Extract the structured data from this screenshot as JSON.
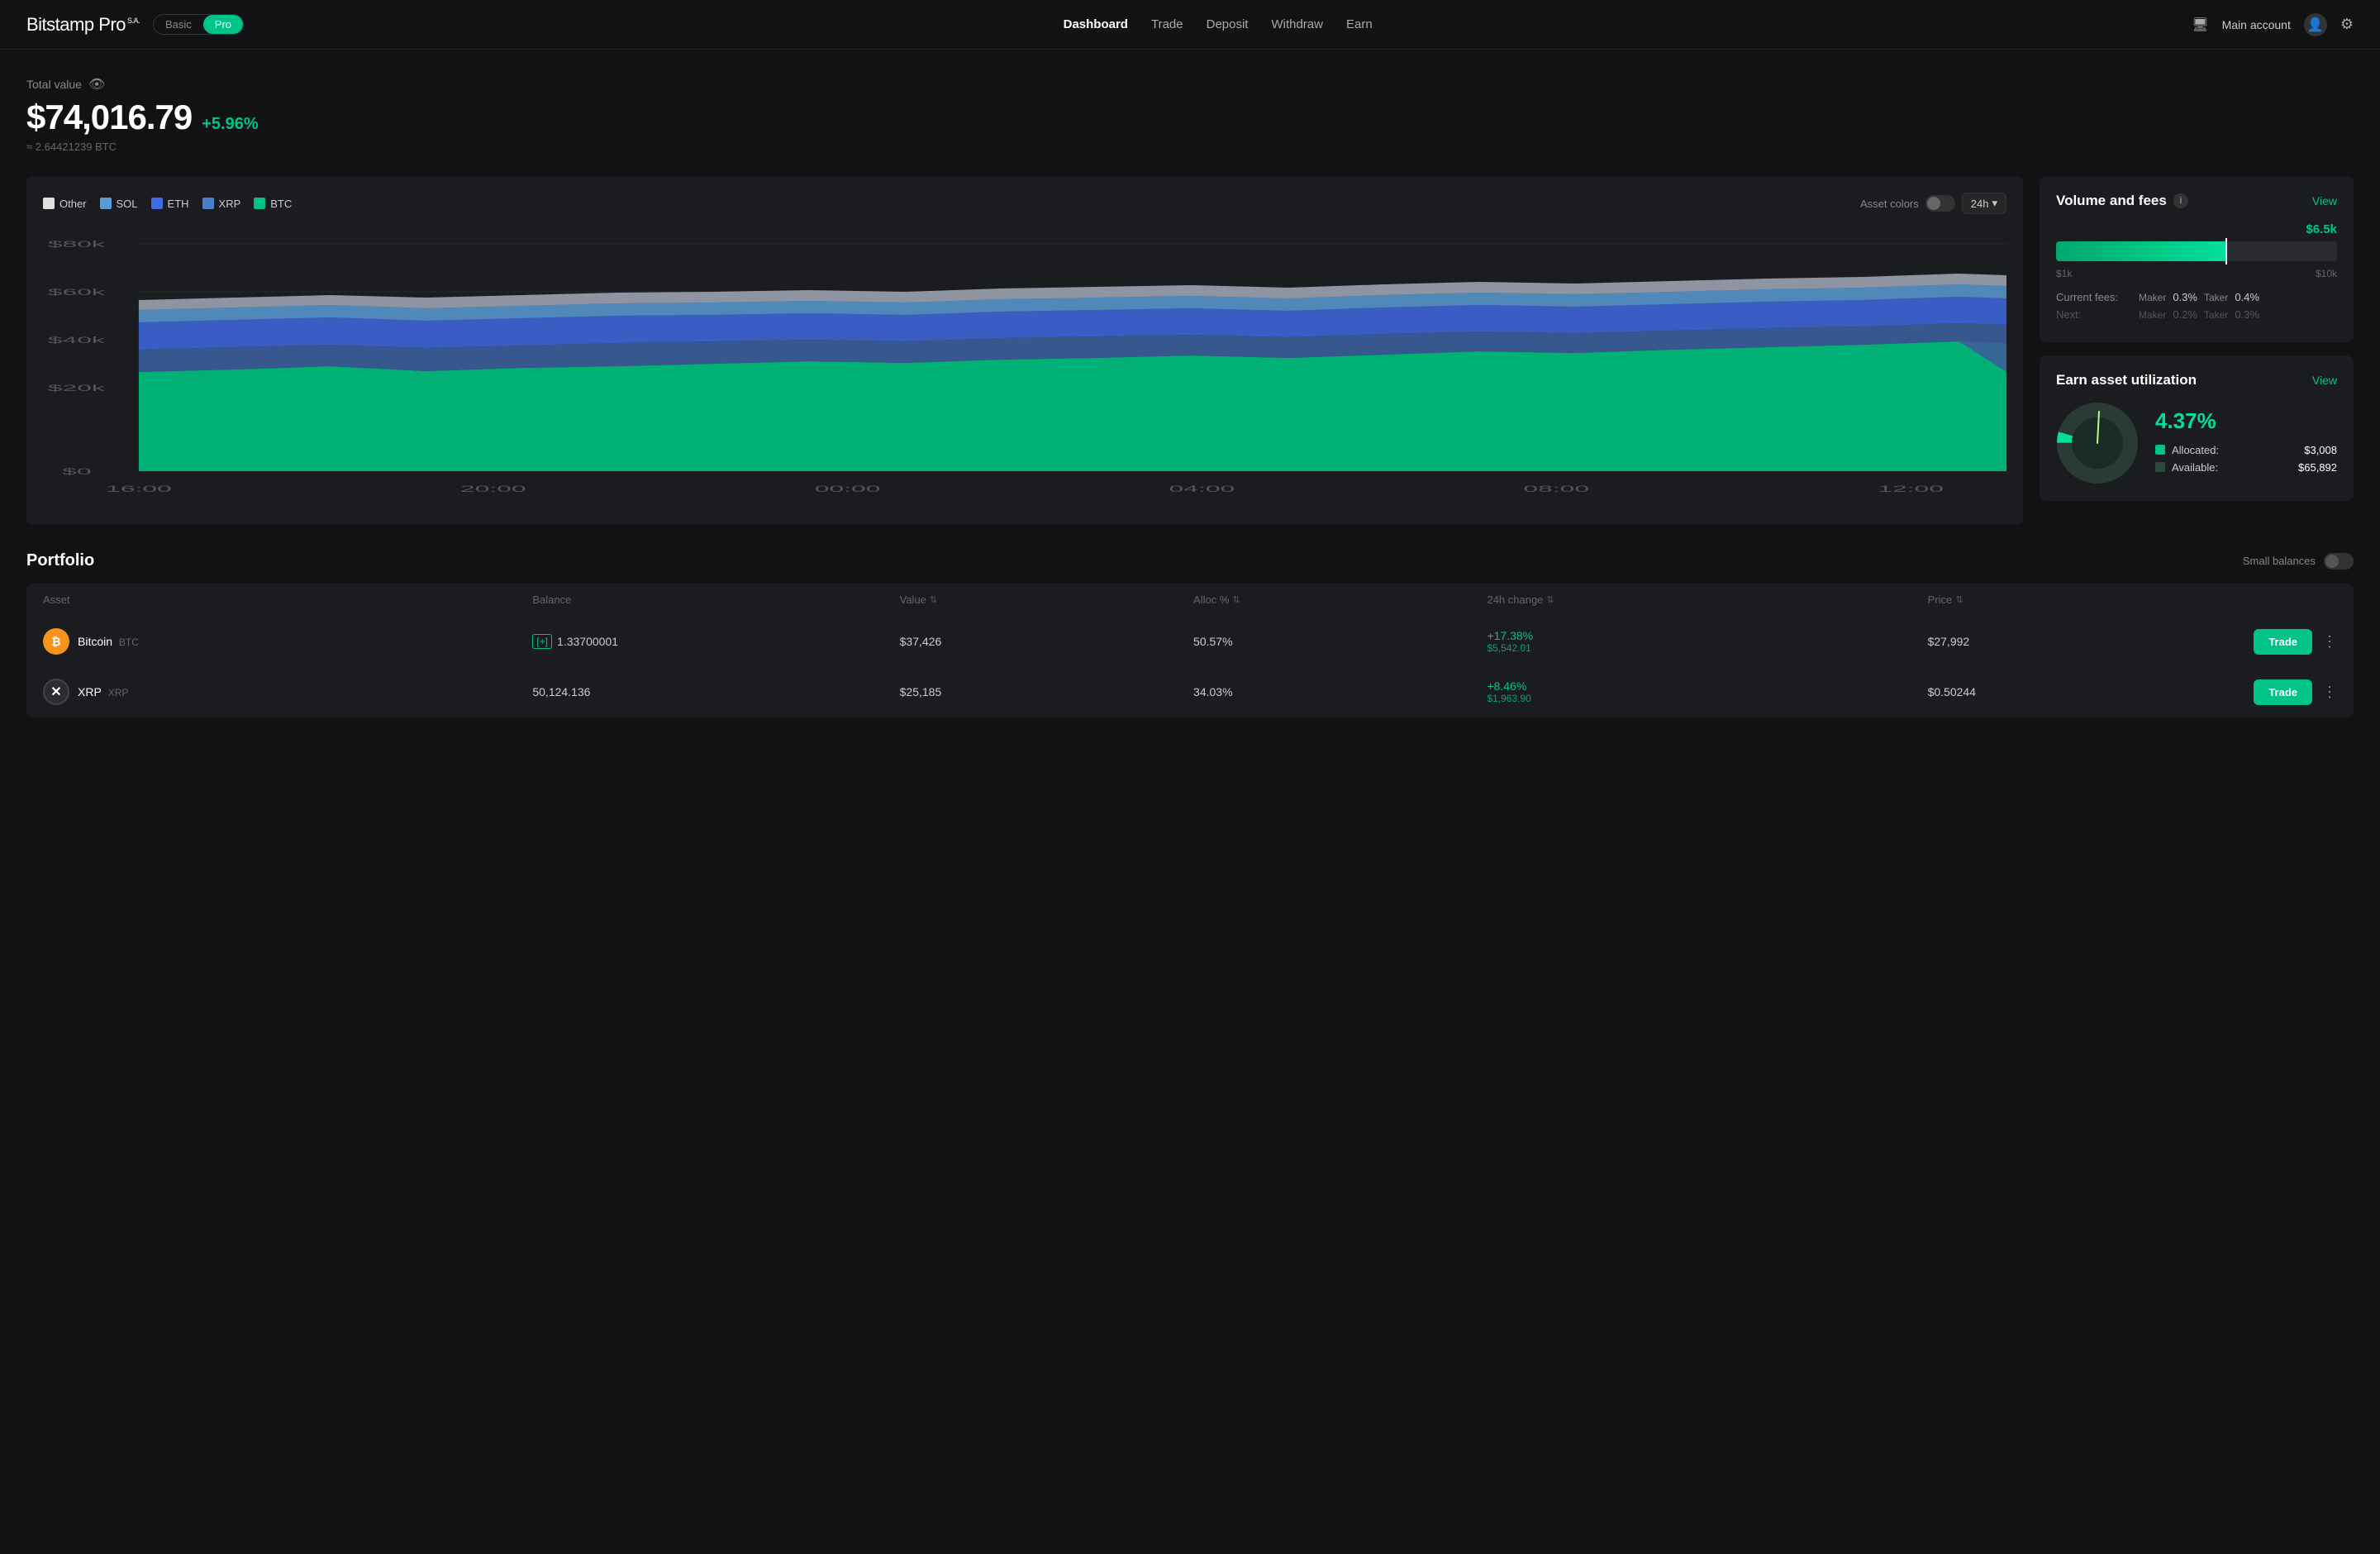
{
  "header": {
    "logo": "Bitstamp",
    "logo_pro": "Pro",
    "logo_sa": "S.A.",
    "plan_basic": "Basic",
    "plan_pro": "Pro",
    "nav": [
      {
        "label": "Dashboard",
        "active": true
      },
      {
        "label": "Trade",
        "active": false
      },
      {
        "label": "Deposit",
        "active": false
      },
      {
        "label": "Withdraw",
        "active": false
      },
      {
        "label": "Earn",
        "active": false
      }
    ],
    "main_account": "Main account",
    "settings_icon": "⚙"
  },
  "total_value": {
    "label": "Total value",
    "amount": "$74,016.79",
    "change": "+5.96%",
    "btc": "≈ 2.64421239 BTC"
  },
  "chart": {
    "legend": [
      {
        "label": "Other",
        "color": "#e0e0e0"
      },
      {
        "label": "SOL",
        "color": "#5b9bd5"
      },
      {
        "label": "ETH",
        "color": "#4169e1"
      },
      {
        "label": "XRP",
        "color": "#4a7ec7"
      },
      {
        "label": "BTC",
        "color": "#00c389"
      }
    ],
    "asset_colors_label": "Asset colors",
    "time_label": "24h",
    "y_labels": [
      "$80k",
      "$60k",
      "$40k",
      "$20k",
      "$0"
    ],
    "x_labels": [
      "16:00",
      "20:00",
      "00:00",
      "04:00",
      "08:00",
      "12:00"
    ]
  },
  "volume_fees": {
    "title": "Volume and fees",
    "view_label": "View",
    "progress_value": "$6.5k",
    "range_min": "$1k",
    "range_max": "$10k",
    "progress_pct": 61,
    "current_fees_label": "Current fees:",
    "maker_label": "Maker",
    "maker_val": "0.3%",
    "taker_label": "Taker",
    "taker_val": "0.4%",
    "next_label": "Next:",
    "next_maker_label": "Maker",
    "next_maker_val": "0.2%",
    "next_taker_label": "Taker",
    "next_taker_val": "0.3%"
  },
  "earn": {
    "title": "Earn asset utilization",
    "view_label": "View",
    "percent": "4.37%",
    "allocated_label": "Allocated:",
    "allocated_val": "$3,008",
    "available_label": "Available:",
    "available_val": "$65,892",
    "allocated_color": "#00c389",
    "available_color": "#2a3a35"
  },
  "portfolio": {
    "title": "Portfolio",
    "small_balances_label": "Small balances",
    "columns": [
      "Asset",
      "Balance",
      "Value",
      "Alloc %",
      "24h change",
      "Price",
      ""
    ],
    "rows": [
      {
        "icon": "₿",
        "icon_class": "btc",
        "name": "Bitcoin",
        "ticker": "BTC",
        "balance": "1.33700001",
        "balance_plus": true,
        "value": "$37,426",
        "alloc": "50.57%",
        "change_pct": "+17.38%",
        "change_usd": "$5,542.01",
        "price": "$27,992"
      },
      {
        "icon": "✕",
        "icon_class": "xrp",
        "name": "XRP",
        "ticker": "XRP",
        "balance": "50,124.136",
        "balance_plus": false,
        "value": "$25,185",
        "alloc": "34.03%",
        "change_pct": "+8.46%",
        "change_usd": "$1,963.90",
        "price": "$0.50244"
      }
    ]
  }
}
